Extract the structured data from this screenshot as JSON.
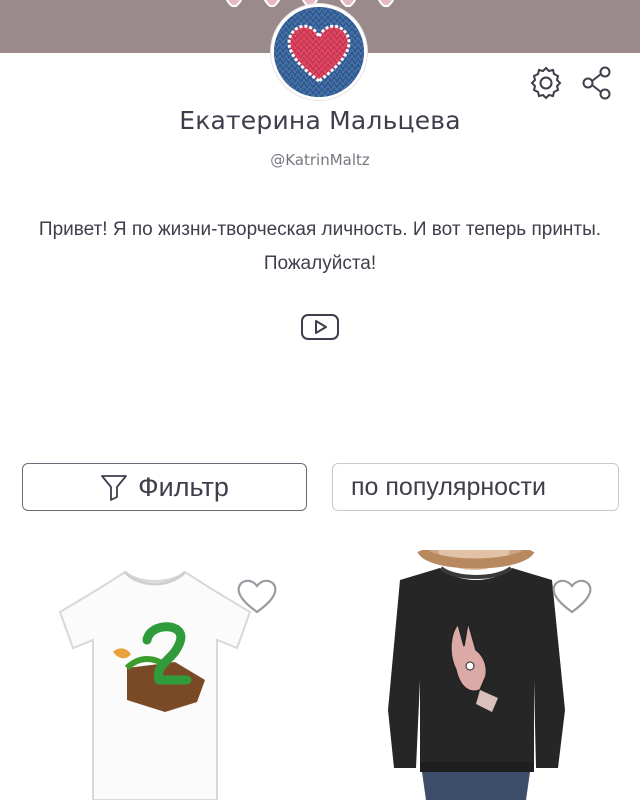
{
  "profile": {
    "name": "Екатерина Мальцева",
    "handle": "@KatrinMaltz",
    "bio": "Привет! Я по жизни-творческая личность. И вот теперь принты. Пожалуйста!"
  },
  "icons": {
    "settings": "gear-icon",
    "share": "share-icon",
    "youtube": "youtube-icon",
    "filter": "filter-funnel-icon",
    "favorite": "heart-outline-icon"
  },
  "controls": {
    "filter_label": "Фильтр",
    "sort_label": "по популярности"
  },
  "colors": {
    "cover": "#9a8a8c",
    "heart": "#d0324f",
    "avatar_bg": "#2e5a94",
    "text": "#3e3e4c"
  }
}
